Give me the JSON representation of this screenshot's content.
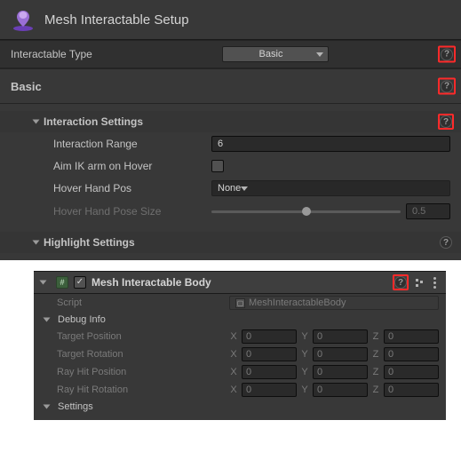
{
  "header": {
    "title": "Mesh Interactable Setup"
  },
  "interactableType": {
    "label": "Interactable Type",
    "value": "Basic"
  },
  "section_basic": {
    "title": "Basic"
  },
  "interactionSettings": {
    "title": "Interaction Settings",
    "range": {
      "label": "Interaction Range",
      "value": "6"
    },
    "aimIK": {
      "label": "Aim IK arm on Hover",
      "checked": false
    },
    "hoverHandPos": {
      "label": "Hover Hand Pos",
      "value": "None"
    },
    "hoverPoseSize": {
      "label": "Hover Hand Pose Size",
      "value": "0.5",
      "percent": 50
    }
  },
  "highlightSettings": {
    "title": "Highlight Settings"
  },
  "component": {
    "title": "Mesh Interactable Body",
    "enabled": true,
    "script": {
      "label": "Script",
      "value": "MeshInteractableBody"
    },
    "debugInfo": {
      "title": "Debug Info",
      "rows": [
        {
          "label": "Target Position",
          "x": "0",
          "y": "0",
          "z": "0"
        },
        {
          "label": "Target Rotation",
          "x": "0",
          "y": "0",
          "z": "0"
        },
        {
          "label": "Ray Hit Position",
          "x": "0",
          "y": "0",
          "z": "0"
        },
        {
          "label": "Ray Hit Rotation",
          "x": "0",
          "y": "0",
          "z": "0"
        }
      ]
    },
    "settings": {
      "title": "Settings"
    }
  },
  "vecLabels": {
    "x": "X",
    "y": "Y",
    "z": "Z"
  }
}
